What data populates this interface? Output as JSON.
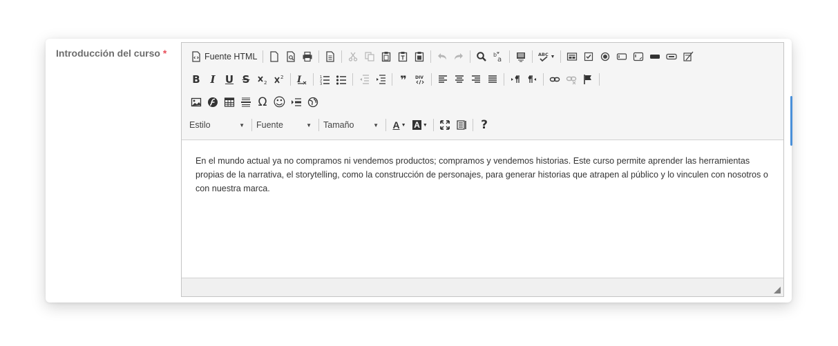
{
  "field": {
    "label": "Introducción del curso",
    "required_mark": "*"
  },
  "toolbar": {
    "source_label": "Fuente HTML",
    "style_combo": "Estilo",
    "font_combo": "Fuente",
    "size_combo": "Tamaño"
  },
  "editor": {
    "content": "En el mundo actual ya no compramos ni vendemos productos; compramos y vendemos historias. Este curso permite aprender las herramientas propias de la narrativa, el storytelling, como la construcción de personajes, para generar historias que atrapen al público y lo vinculen con nosotros o con nuestra marca."
  },
  "glyphs": {
    "omega": "Ω",
    "help": "?",
    "quote": "❞",
    "smiley": "☺",
    "bold": "B",
    "italic": "I",
    "underline": "U",
    "strike": "S",
    "font_color": "A",
    "bg_color": "A"
  },
  "colors": {
    "required": "#e8505b",
    "label": "#6d6d6d",
    "toolbar_bg": "#f5f5f5"
  }
}
